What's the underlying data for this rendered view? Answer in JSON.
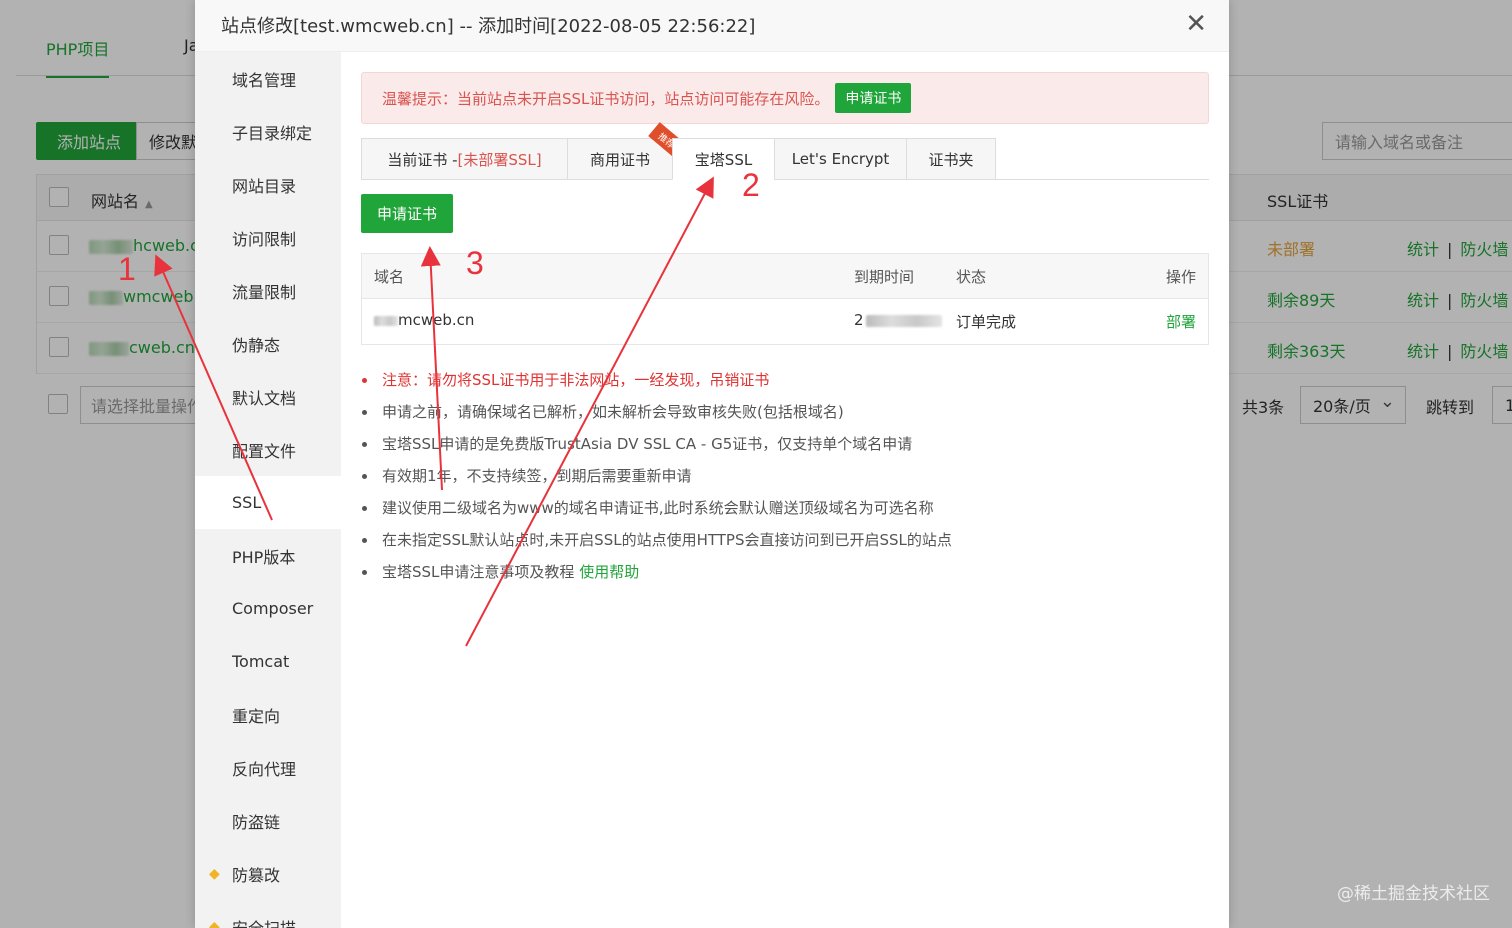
{
  "bg": {
    "tabs": [
      "PHP项目",
      "Ja"
    ],
    "add_site": "添加站点",
    "modify": "修改默",
    "search_placeholder": "请输入域名或备注",
    "col_name": "网站名",
    "col_ssl": "SSL证书",
    "rows": [
      {
        "site": "hcweb.c",
        "ssl": "未部署",
        "ssl_color": "#e6a23c"
      },
      {
        "site": "wmcweb.",
        "ssl": "剩余89天",
        "ssl_color": "#20a53a"
      },
      {
        "site": "cweb.cn",
        "ssl": "剩余363天",
        "ssl_color": "#20a53a"
      }
    ],
    "op_stats": "统计",
    "op_sep": "|",
    "op_firewall": "防火墙",
    "batch_placeholder": "请选择批量操作",
    "total": "共3条",
    "page_size": "20条/页",
    "jump_to": "跳转到",
    "jump_value": "1"
  },
  "modal": {
    "title": "站点修改[test.wmcweb.cn] -- 添加时间[2022-08-05 22:56:22]",
    "close": "✕",
    "nav": [
      "域名管理",
      "子目录绑定",
      "网站目录",
      "访问限制",
      "流量限制",
      "伪静态",
      "默认文档",
      "配置文件",
      "SSL",
      "PHP版本",
      "Composer",
      "Tomcat",
      "重定向",
      "反向代理",
      "防盗链",
      "防篡改",
      "安全扫描"
    ],
    "alert_text": "温馨提示：当前站点未开启SSL证书访问，站点访问可能存在风险。",
    "alert_btn": "申请证书",
    "tabs": {
      "current_prefix": "当前证书 - ",
      "current_status": "[未部署SSL]",
      "commercial": "商用证书",
      "recommend": "推荐",
      "baota": "宝塔SSL",
      "letsencrypt": "Let's Encrypt",
      "folder": "证书夹"
    },
    "apply_btn": "申请证书",
    "table": {
      "headers": {
        "domain": "域名",
        "expire": "到期时间",
        "status": "状态",
        "op": "操作"
      },
      "row": {
        "domain": "mcweb.cn",
        "expire": "2",
        "status": "订单完成",
        "op": "部署"
      }
    },
    "notes": {
      "warn": "注意：请勿将SSL证书用于非法网站，一经发现，吊销证书",
      "n1": "申请之前，请确保域名已解析，如未解析会导致审核失败(包括根域名)",
      "n2": "宝塔SSL申请的是免费版TrustAsia DV SSL CA - G5证书，仅支持单个域名申请",
      "n3": "有效期1年，不支持续签，到期后需要重新申请",
      "n4": "建议使用二级域名为www的域名申请证书,此时系统会默认赠送顶级域名为可选名称",
      "n5": "在未指定SSL默认站点时,未开启SSL的站点使用HTTPS会直接访问到已开启SSL的站点",
      "n6": "宝塔SSL申请注意事项及教程",
      "help": "使用帮助"
    }
  },
  "annotations": {
    "n1": "1",
    "n2": "2",
    "n3": "3"
  },
  "watermark": "@稀土掘金技术社区",
  "colors": {
    "green": "#20a53a",
    "red": "#e03333",
    "arrow": "#e8323c"
  }
}
